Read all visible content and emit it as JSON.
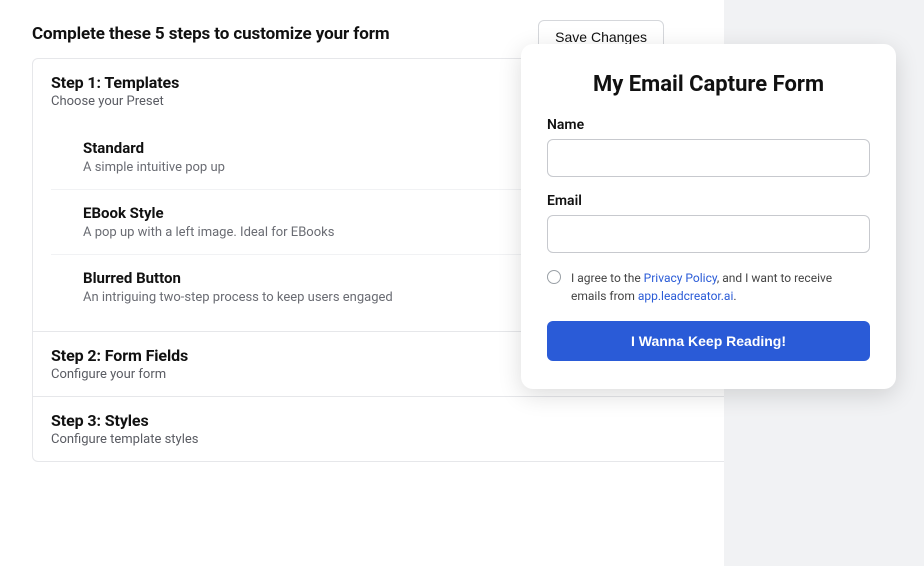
{
  "header": {
    "title": "Complete these 5 steps to customize your form",
    "save_label": "Save Changes"
  },
  "steps": [
    {
      "title": "Step 1: Templates",
      "subtitle": "Choose your Preset",
      "expanded": true,
      "templates": [
        {
          "name": "Standard",
          "desc": "A simple intuitive pop up"
        },
        {
          "name": "EBook Style",
          "desc": "A pop up with a left image. Ideal for EBooks"
        },
        {
          "name": "Blurred Button",
          "desc": "An intriguing two-step process to keep users engaged"
        }
      ]
    },
    {
      "title": "Step 2: Form Fields",
      "subtitle": "Configure your form",
      "expanded": false
    },
    {
      "title": "Step 3: Styles",
      "subtitle": "Configure template styles",
      "expanded": false
    }
  ],
  "preview": {
    "title": "My Email Capture Form",
    "name_label": "Name",
    "email_label": "Email",
    "consent_prefix": "I agree to the ",
    "consent_link1": "Privacy Policy",
    "consent_mid": ", and I want to receive emails from ",
    "consent_link2": "app.leadcreator.ai",
    "consent_suffix": ".",
    "submit_label": "I Wanna Keep Reading!"
  }
}
